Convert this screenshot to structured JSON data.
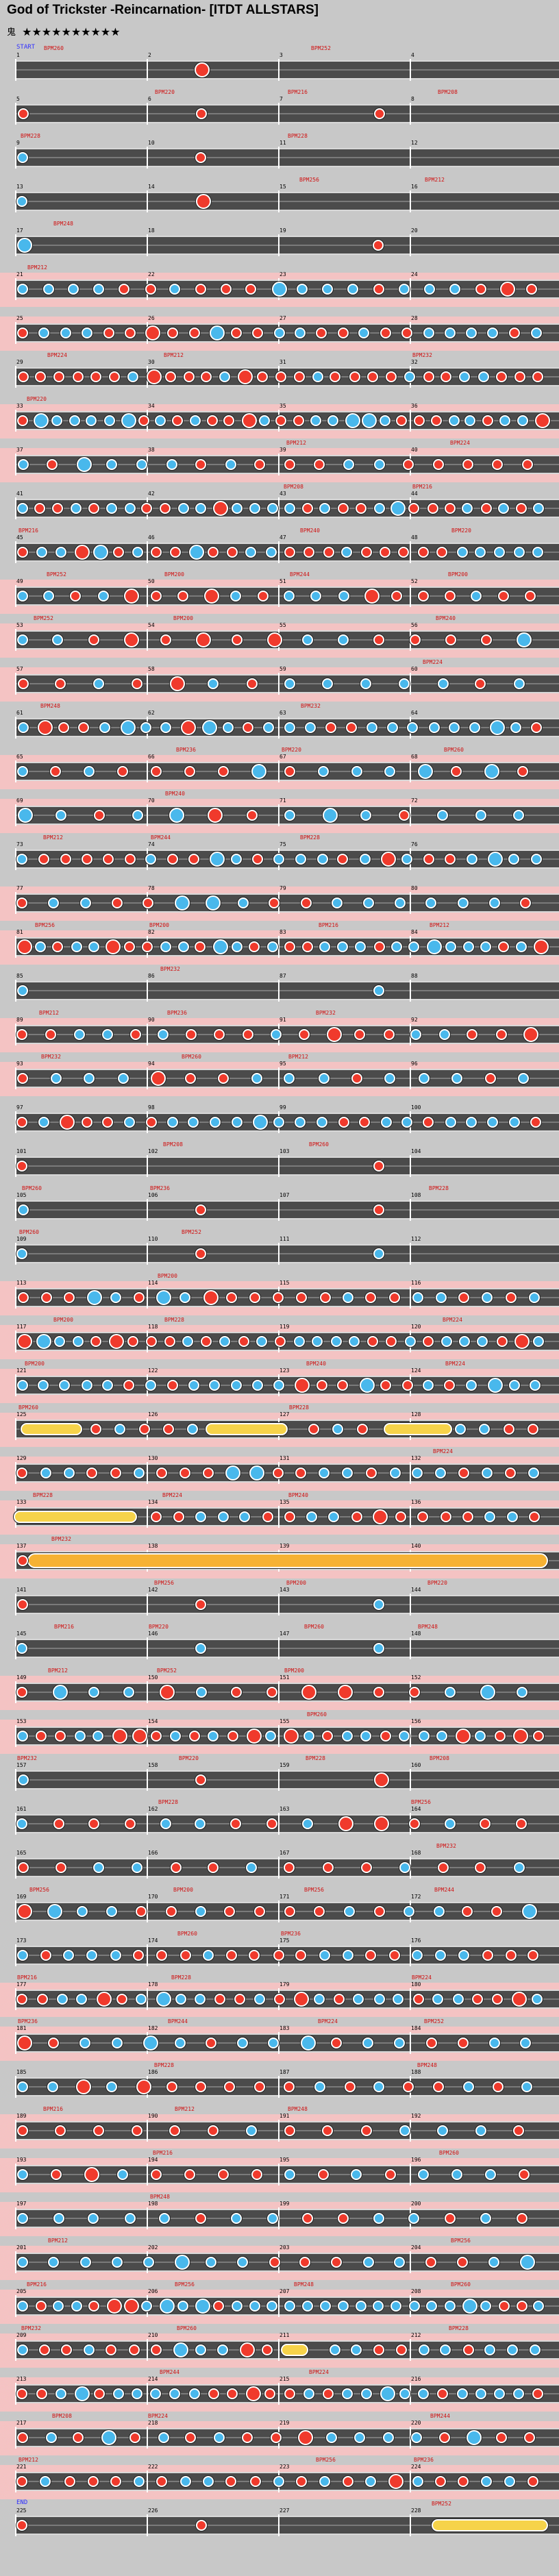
{
  "header": {
    "title": "God of Trickster -Reincarnation- [ITDT ALLSTARS]",
    "difficulty_label": "鬼",
    "stars": "★★★★★★★★★★",
    "star_count": 10
  },
  "chart_data": {
    "type": "note-chart",
    "title": "God of Trickster -Reincarnation- [ITDT ALLSTARS]",
    "course": "鬼",
    "level": 10,
    "rows": 57,
    "measures_per_row": 4,
    "start_marker": "START",
    "end_marker": "END",
    "bpm_samples": [
      "BPM200",
      "BPM208",
      "BPM212",
      "BPM216",
      "BPM220",
      "BPM224",
      "BPM228",
      "BPM232",
      "BPM236",
      "BPM240",
      "BPM244",
      "BPM248",
      "BPM252",
      "BPM256",
      "BPM260"
    ],
    "colors": {
      "don": "#f03a2c",
      "ka": "#49b8ec",
      "roll": "#f6d34a",
      "big_roll": "#f6b234",
      "gogo": "#f4c3c3",
      "lane": "#4b4b4b"
    }
  }
}
